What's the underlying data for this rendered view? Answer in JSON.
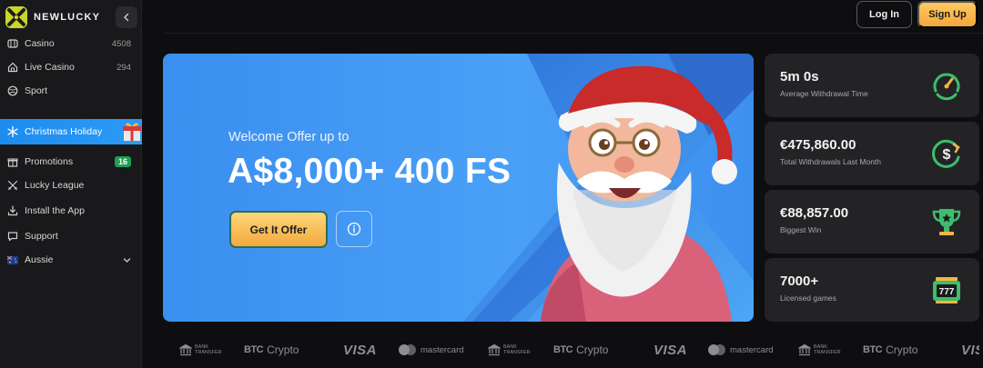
{
  "brand": {
    "name": "NEWLUCKY"
  },
  "sidebar": {
    "items": [
      {
        "label": "Casino",
        "count": "4508",
        "icon": "casino-icon"
      },
      {
        "label": "Live Casino",
        "count": "294",
        "icon": "live-casino-icon"
      },
      {
        "label": "Sport",
        "icon": "sport-ball-icon"
      },
      {
        "label": "Christmas Holiday",
        "icon": "snowflake-icon",
        "active": true
      },
      {
        "label": "Promotions",
        "badge": "16",
        "icon": "gift-icon"
      },
      {
        "label": "Lucky League",
        "icon": "crossed-swords-icon"
      },
      {
        "label": "Install the App",
        "icon": "download-icon"
      },
      {
        "label": "Support",
        "icon": "chat-icon"
      },
      {
        "label": "Aussie",
        "icon": "australia-flag-icon"
      }
    ]
  },
  "header": {
    "login_label": "Log In",
    "signup_label": "Sign Up"
  },
  "banner": {
    "subtitle": "Welcome Offer up to",
    "headline": "A$8,000+ 400 FS",
    "cta_label": "Get It Offer"
  },
  "stats": [
    {
      "value": "5m 0s",
      "label": "Average Withdrawal Time",
      "icon": "gauge-icon"
    },
    {
      "value": "€475,860.00",
      "label": "Total Withdrawals Last Month",
      "icon": "dollar-cycle-icon"
    },
    {
      "value": "€88,857.00",
      "label": "Biggest Win",
      "icon": "trophy-icon"
    },
    {
      "value": "7000+",
      "label": "Licensed games",
      "icon": "slot-machine-icon"
    }
  ],
  "payments": {
    "bank_line1": "BANK",
    "bank_line2": "TRANSFER",
    "btc": "BTC",
    "crypto": "Crypto",
    "visa": "VISA",
    "mastercard": "mastercard"
  },
  "colors": {
    "accent_blue": "#1c8cf0",
    "accent_gold": "#f3a83c",
    "stat_green": "#3dbd6e",
    "badge_green": "#1f9e53"
  }
}
